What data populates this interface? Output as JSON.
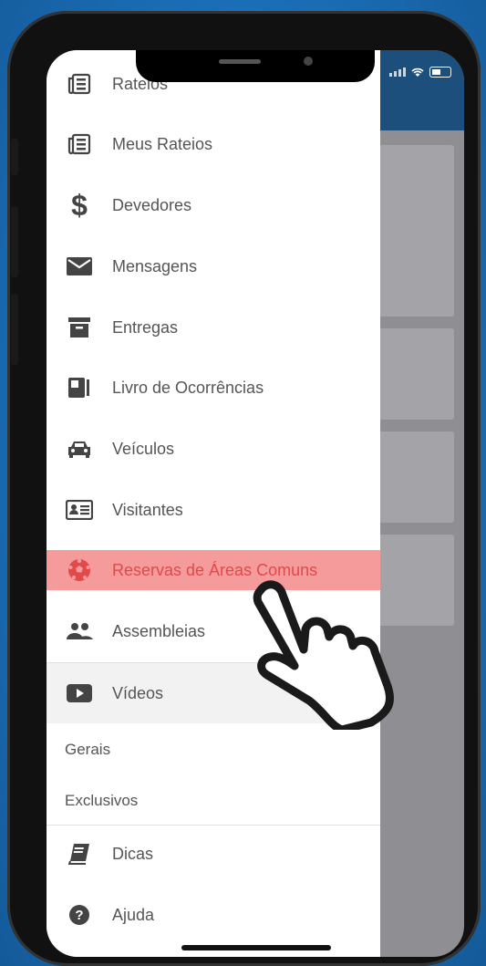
{
  "drawer": {
    "items": [
      {
        "label": "Rateios",
        "icon": "newspaper-icon"
      },
      {
        "label": "Meus Rateios",
        "icon": "newspaper-icon"
      },
      {
        "label": "Devedores",
        "icon": "dollar-icon"
      },
      {
        "label": "Mensagens",
        "icon": "envelope-icon"
      },
      {
        "label": "Entregas",
        "icon": "archive-box-icon"
      },
      {
        "label": "Livro de Ocorrências",
        "icon": "book-icon"
      },
      {
        "label": "Veículos",
        "icon": "car-icon"
      },
      {
        "label": "Visitantes",
        "icon": "id-card-icon"
      },
      {
        "label": "Reservas de Áreas Comuns",
        "icon": "soccer-ball-icon",
        "active": true
      },
      {
        "label": "Assembleias",
        "icon": "people-icon"
      },
      {
        "label": "Vídeos",
        "icon": "video-play-icon"
      }
    ],
    "video_subitems": [
      "Gerais",
      "Exclusivos"
    ],
    "bottom_items": [
      {
        "label": "Dicas",
        "icon": "book-open-icon"
      },
      {
        "label": "Ajuda",
        "icon": "question-circle-icon"
      }
    ]
  },
  "colors": {
    "highlight_bg": "#f59b9b",
    "highlight_text": "#e04a4a",
    "appbar": "#1c4f7c"
  }
}
